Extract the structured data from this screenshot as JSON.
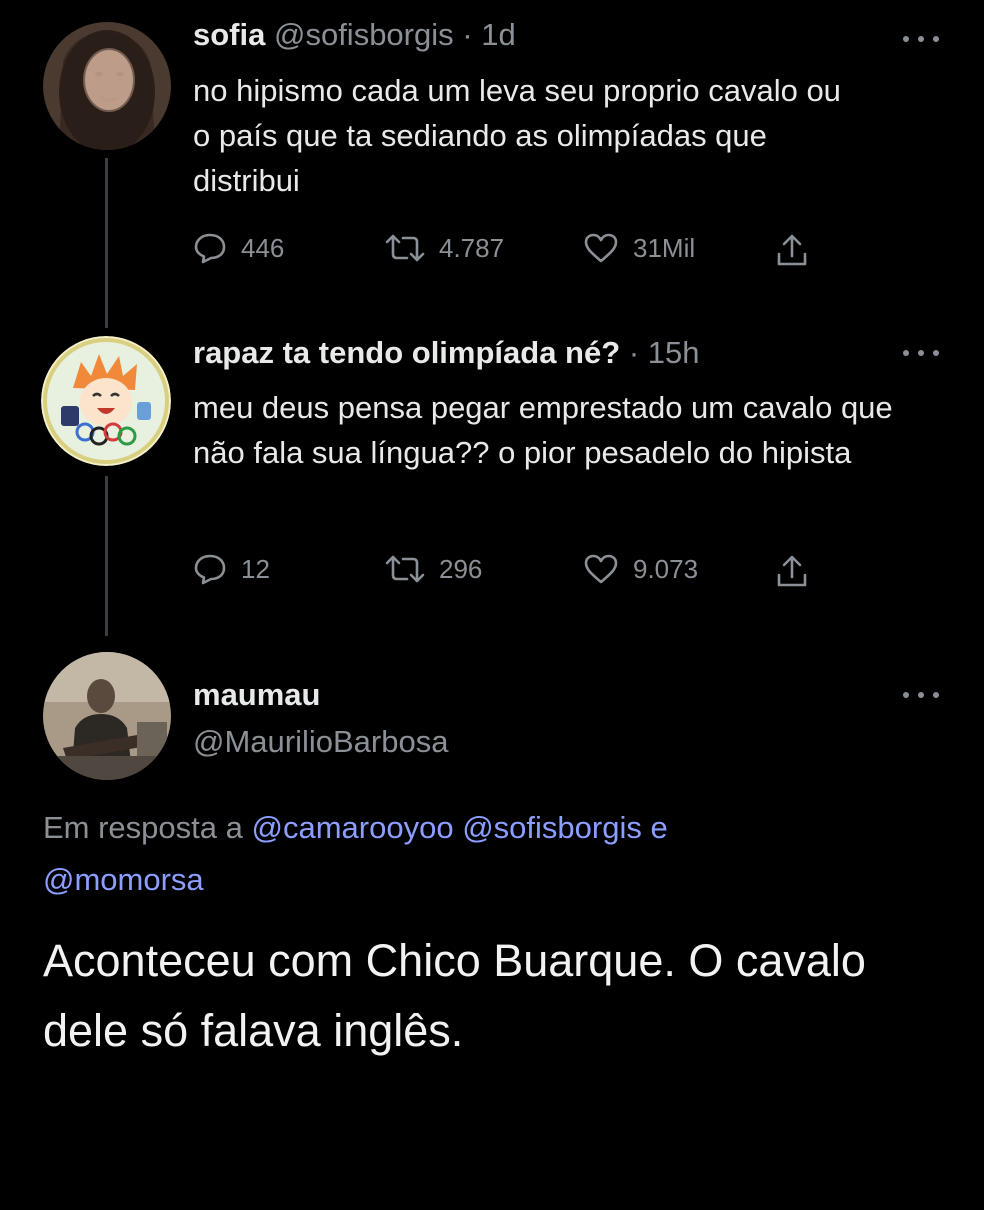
{
  "tweets": [
    {
      "name": "sofia",
      "handle": "@sofisborgis",
      "time": "· 1d",
      "text": "no hipismo cada um leva seu proprio cavalo ou o país que ta sediando as olimpíadas que distribui",
      "replies": "446",
      "retweets": "4.787",
      "likes": "31Mil",
      "avatar_icon": "profile-photo-icon"
    },
    {
      "name": "rapaz ta tendo olimpíada né?",
      "handle": "",
      "time": "· 15h",
      "text": "meu deus pensa pegar emprestado um cavalo que não fala sua língua?? o pior pesadelo do hipista",
      "replies": "12",
      "retweets": "296",
      "likes": "9.073",
      "avatar_icon": "anime-character-avatar-icon"
    }
  ],
  "main": {
    "name": "maumau",
    "handle": "@MaurilioBarbosa",
    "reply_prefix": "Em resposta a",
    "mention_1": "@camarooyoo",
    "mention_2": "@sofisborgis",
    "reply_conj": "e",
    "mention_3": "@momorsa",
    "text": "Aconteceu com Chico Buarque. O cavalo dele só falava inglês.",
    "avatar_icon": "guitarist-photo-avatar-icon"
  },
  "colors": {
    "background": "#000000",
    "text": "#e7e9ea",
    "secondary": "#8b9096",
    "mention": "#8c9eff",
    "thread_line": "#3a3d41"
  }
}
